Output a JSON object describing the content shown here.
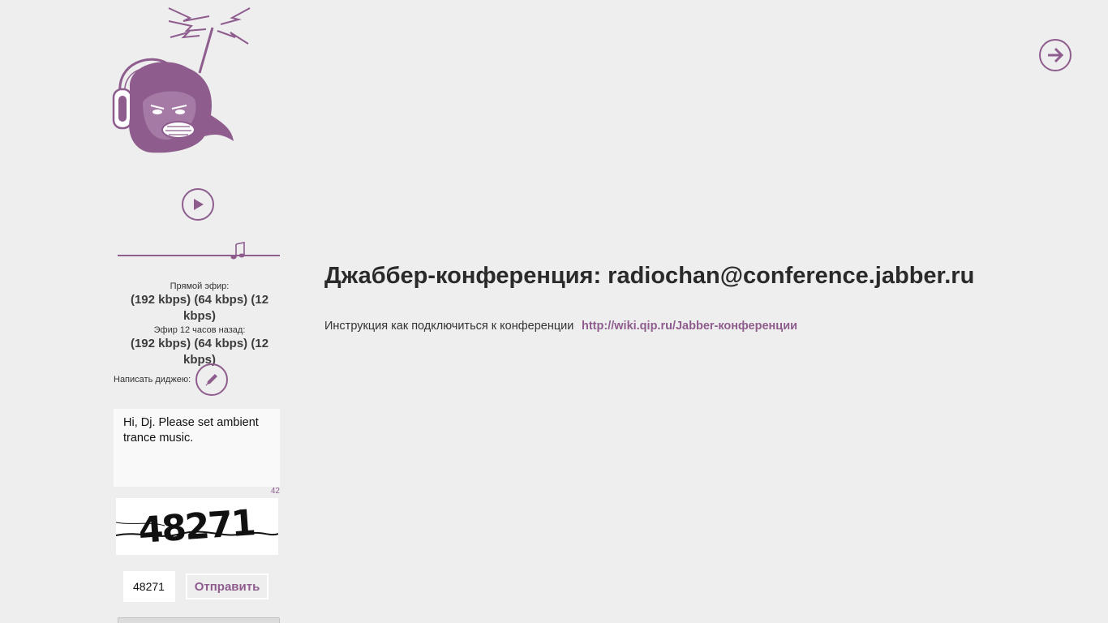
{
  "colors": {
    "accent": "#8e5d8e",
    "background": "#eeeeee",
    "text": "#333333"
  },
  "header": {
    "forward_icon": "arrow-right-circle-icon"
  },
  "player": {
    "play_icon": "play-icon",
    "volume_icon": "music-note-icon"
  },
  "streams": {
    "live_caption": "Прямой эфир:",
    "live_links": [
      "(192 kbps)",
      "(64 kbps)",
      "(12 kbps)"
    ],
    "archive_caption": "Эфир 12 часов назад:",
    "archive_links": [
      "(192 kbps)",
      "(64 kbps)",
      "(12 kbps)"
    ]
  },
  "message": {
    "label": "Написать диджею:",
    "edit_icon": "pencil-icon",
    "text": "Hi, Dj. Please set ambient trance music.",
    "chars_left": "42",
    "captcha_code": "48271",
    "captcha_input": "48271",
    "send_label": "Отправить"
  },
  "conference": {
    "title": "Джаббер-конференция: radiochan@conference.jabber.ru",
    "instruction_text": "Инструкция как подключиться к конференции",
    "instruction_link": "http://wiki.qip.ru/Jabber-конференции"
  }
}
